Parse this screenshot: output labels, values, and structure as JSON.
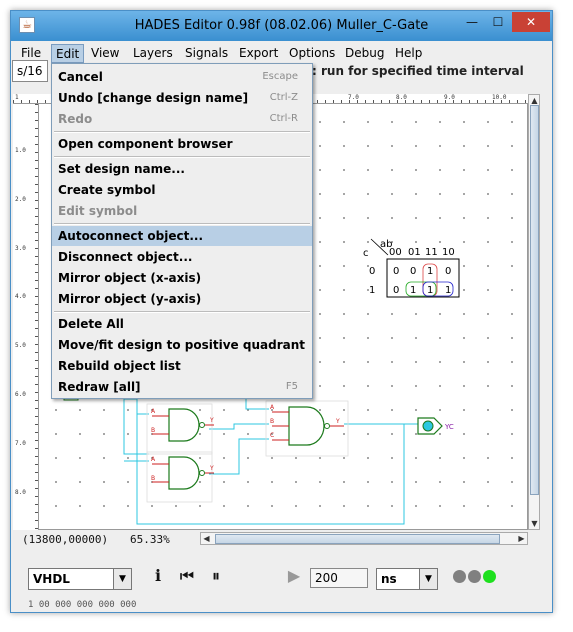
{
  "window": {
    "title": "HADES Editor 0.98f (08.02.06)    Muller_C-Gate",
    "icon": "java-cup-icon",
    "minimize": "—",
    "maximize": "☐",
    "close": "✕"
  },
  "menubar": [
    "File",
    "Edit",
    "View",
    "Layers",
    "Signals",
    "Export",
    "Options",
    "Debug",
    "Help"
  ],
  "toolbar": {
    "left_field": "s/16",
    "message": ": run for specified time interval"
  },
  "ruler": {
    "top": [
      "1",
      "7.0",
      "8.0",
      "9.0",
      "10.0"
    ],
    "left": [
      "1.0",
      "2.0",
      "3.0",
      "4.0",
      "5.0",
      "6.0",
      "7.0",
      "8.0"
    ]
  },
  "edit_menu": {
    "items": [
      {
        "label": "Cancel",
        "accel": "Escape",
        "enabled": true
      },
      {
        "label": "Undo [change design name]",
        "accel": "Ctrl-Z",
        "enabled": true
      },
      {
        "label": "Redo",
        "accel": "Ctrl-R",
        "enabled": false
      },
      {
        "label": "Open component browser",
        "accel": "",
        "enabled": true
      },
      {
        "label": "Set design name...",
        "accel": "",
        "enabled": true
      },
      {
        "label": "Create symbol",
        "accel": "",
        "enabled": true
      },
      {
        "label": "Edit symbol",
        "accel": "",
        "enabled": false
      },
      {
        "label": "Autoconnect object...",
        "accel": "",
        "enabled": true,
        "highlighted": true
      },
      {
        "label": "Disconnect object...",
        "accel": "",
        "enabled": true
      },
      {
        "label": "Mirror object (x-axis)",
        "accel": "",
        "enabled": true
      },
      {
        "label": "Mirror object (y-axis)",
        "accel": "",
        "enabled": true
      },
      {
        "label": "Delete All",
        "accel": "",
        "enabled": true
      },
      {
        "label": "Move/fit design to positive quadrant",
        "accel": "",
        "enabled": true
      },
      {
        "label": "Rebuild object list",
        "accel": "",
        "enabled": true
      },
      {
        "label": "Redraw [all]",
        "accel": "F5",
        "enabled": true
      }
    ]
  },
  "kmap": {
    "var_ab": "ab",
    "var_c": "c",
    "cols": [
      "00",
      "01",
      "11",
      "10"
    ],
    "rows": [
      "0",
      "1"
    ],
    "cells": [
      [
        "0",
        "0",
        "1",
        "0"
      ],
      [
        "0",
        "1",
        "1",
        "1"
      ]
    ]
  },
  "circuit": {
    "output_label": "YC",
    "pin_a": "A",
    "pin_b": "B",
    "pin_y": "Y",
    "pin_c": "C"
  },
  "status": {
    "coords": "(13800,00000)",
    "zoom": "65.33%"
  },
  "bottom": {
    "language": "VHDL",
    "time_value": "200",
    "time_unit": "ns",
    "partial_text": "1 00 000 000 000 000"
  },
  "colors": {
    "wire": "#2cc7e0",
    "gate": "#1c7a1c",
    "pin": "#cc1f1f",
    "accent": "#3a8fd0",
    "led_green": "#1ee01e",
    "led_gray": "#808080"
  }
}
